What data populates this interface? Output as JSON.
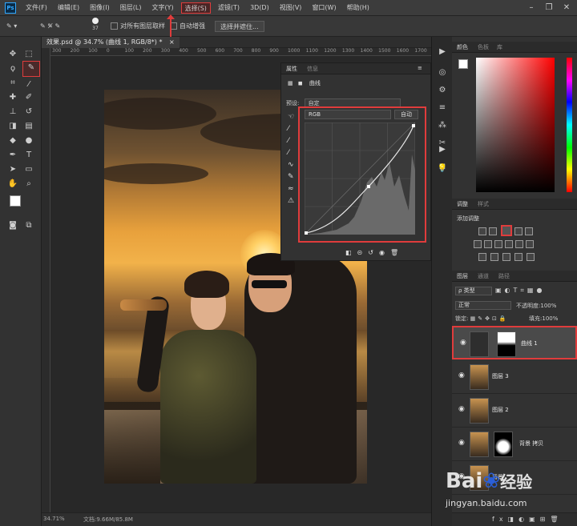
{
  "menubar": {
    "logo": "Ps",
    "items": [
      "文件(F)",
      "编辑(E)",
      "图像(I)",
      "图层(L)",
      "文字(Y)",
      "选择(S)",
      "滤镜(T)",
      "3D(D)",
      "视图(V)",
      "窗口(W)",
      "帮助(H)"
    ],
    "highlighted_index": 5
  },
  "options": {
    "brush_size": "37",
    "sample_all_layers": "对所有图层取样",
    "auto_enhance": "自动增强",
    "select_and_mask": "选择并遮住..."
  },
  "document": {
    "tab_title": "效果.psd @ 34.7% (曲线 1, RGB/8*) *",
    "close": "×",
    "ruler_ticks": [
      "300",
      "200",
      "100",
      "0",
      "100",
      "200",
      "300",
      "400",
      "500",
      "600",
      "700",
      "800",
      "900",
      "1000",
      "1100",
      "1200",
      "1300",
      "1400",
      "1500",
      "1600",
      "1700"
    ]
  },
  "status": {
    "zoom": "34.71%",
    "doc_size": "文档:9.66M/85.8M"
  },
  "properties": {
    "tabs": [
      "属性",
      "信息"
    ],
    "title": "曲线",
    "preset_label": "预设:",
    "preset_value": "自定",
    "channel": "RGB",
    "auto": "自动"
  },
  "color_panel": {
    "tabs": [
      "颜色",
      "色板",
      "库"
    ],
    "foreground": "#ffffff",
    "background": "#000000"
  },
  "adjustments": {
    "tabs": [
      "调整",
      "样式"
    ],
    "add_label": "添加调整"
  },
  "layers": {
    "tabs": [
      "图层",
      "通道",
      "路径"
    ],
    "filter_kind": "ρ 类型",
    "blend_mode": "正常",
    "opacity_label": "不透明度:",
    "opacity_value": "100%",
    "lock_label": "锁定:",
    "fill_label": "填充:",
    "fill_value": "100%",
    "items": [
      {
        "name": "曲线 1",
        "selected": true
      },
      {
        "name": "图层 3",
        "selected": false
      },
      {
        "name": "图层 2",
        "selected": false
      },
      {
        "name": "背景 拷贝",
        "selected": false
      },
      {
        "name": "背景",
        "selected": false
      }
    ]
  },
  "watermark": {
    "brand": "Bai",
    "brand_suffix": "经验",
    "url": "jingyan.baidu.com"
  },
  "accent_color": "#e03c3c",
  "ps_blue": "#31a8ff"
}
